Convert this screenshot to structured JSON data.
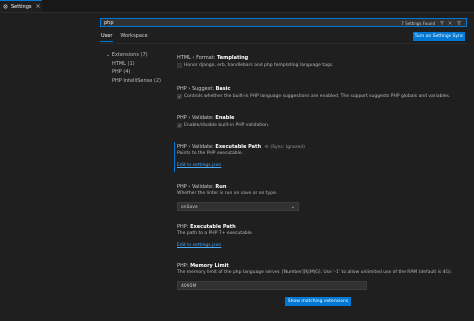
{
  "tab": {
    "title": "Settings",
    "icon": "settings-gear-icon",
    "close": "×"
  },
  "search": {
    "value": "php",
    "count": "7 Settings Found"
  },
  "scope": {
    "user": "User",
    "workspace": "Workspace"
  },
  "turn_on_sync": "Turn on Settings Sync",
  "toc": [
    "Extensions (7)",
    "HTML (1)",
    "PHP (4)",
    "PHP IntelliSense (2)"
  ],
  "settings": [
    {
      "prefix": "HTML › Format: ",
      "name": "Templating",
      "desc": "Honor django, erb, handlebars and php templating language tags.",
      "checked": false
    },
    {
      "prefix": "PHP › Suggest: ",
      "name": "Basic",
      "desc": "Controls whether the built-in PHP language suggestions are enabled. The support suggests PHP globals and variables.",
      "checked": true
    },
    {
      "prefix": "PHP › Validate: ",
      "name": "Enable",
      "desc": "Enable/disable built-in PHP validation.",
      "checked": true
    },
    {
      "prefix": "PHP › Validate: ",
      "name": "Executable Path",
      "sync": "(Sync: Ignored)",
      "desc": "Points to the PHP executable.",
      "link": "Edit in settings.json"
    },
    {
      "prefix": "PHP › Validate: ",
      "name": "Run",
      "desc": "Whether the linter is run on save or on type.",
      "value": "onSave"
    },
    {
      "prefix": "PHP: ",
      "name": "Executable Path",
      "desc": "The path to a PHP 7+ executable.",
      "link": "Edit in settings.json"
    },
    {
      "prefix": "PHP: ",
      "name": "Memory Limit",
      "desc": "The memory limit of the php language server. [Number][K|M|G]. Use '-1' to allow unlimited use of the RAM (default is 4G).",
      "value": "4095M"
    }
  ],
  "show_matching": "Show matching extensions",
  "accent": "#0078d4"
}
